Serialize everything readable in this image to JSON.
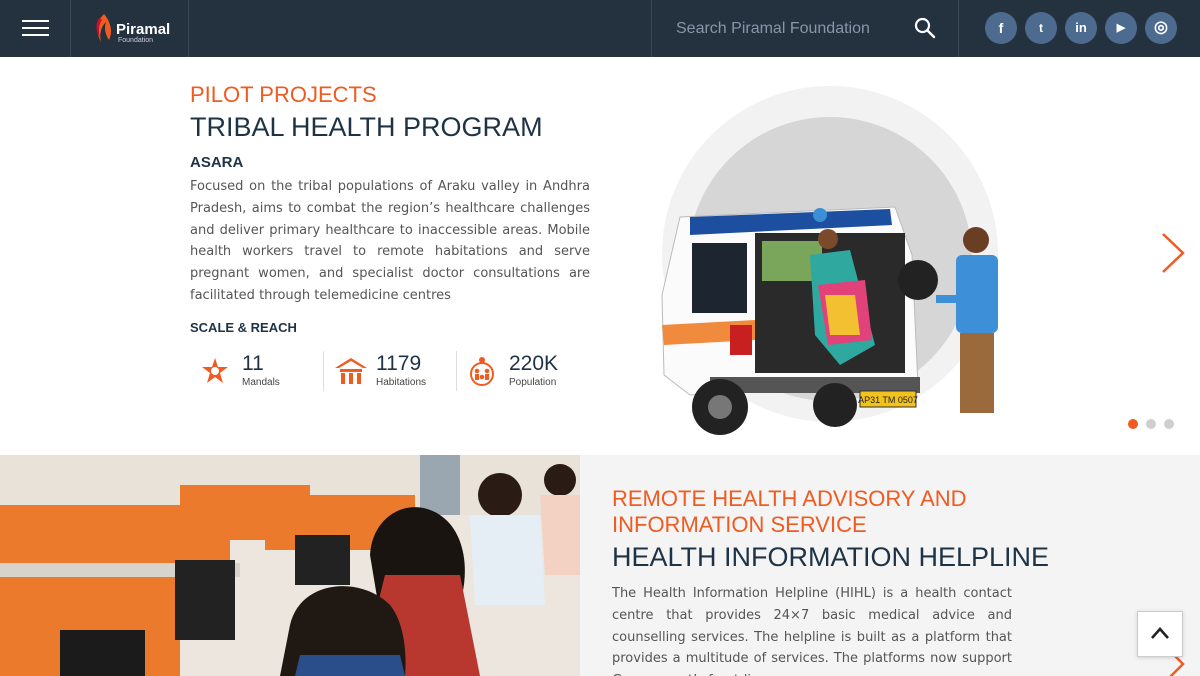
{
  "header": {
    "brand": "Piramal",
    "brand_sub": "Foundation",
    "search_placeholder": "Search Piramal Foundation",
    "social": [
      {
        "icon": "facebook-icon",
        "glyph": "f"
      },
      {
        "icon": "twitter-icon",
        "glyph": "t"
      },
      {
        "icon": "linkedin-icon",
        "glyph": "in"
      },
      {
        "icon": "youtube-icon",
        "glyph": "▶"
      },
      {
        "icon": "instagram-icon",
        "glyph": "◎"
      }
    ]
  },
  "pilot": {
    "kicker": "PILOT PROJECTS",
    "title": "TRIBAL HEALTH PROGRAM",
    "subtitle": "ASARA",
    "description": "Focused on the tribal populations of Araku valley in Andhra Pradesh, aims to combat the region’s healthcare challenges and deliver primary healthcare to inaccessible areas. Mobile health workers travel to remote habitations and serve pregnant women, and specialist doctor consultations are facilitated through telemedicine centres",
    "scale_label": "SCALE & REACH",
    "stats": [
      {
        "value": "11",
        "label": "Mandals",
        "icon": "mandals-icon"
      },
      {
        "value": "1179",
        "label": "Habitations",
        "icon": "habitations-icon"
      },
      {
        "value": "220K",
        "label": "Population",
        "icon": "population-icon"
      }
    ],
    "plate": "AP31 TM 0507",
    "slides": {
      "count": 3,
      "active": 1
    }
  },
  "helpline": {
    "kicker_line1": "REMOTE HEALTH ADVISORY AND",
    "kicker_line2": "INFORMATION SERVICE",
    "title": "HEALTH INFORMATION HELPLINE",
    "description": "The Health Information Helpline (HIHL) is a health contact centre that provides 24×7 basic medical advice and counselling services. The helpline is built as a platform that provides a multitude of services. The platforms now support Government’s front-line"
  },
  "colors": {
    "accent": "#ef5b21",
    "navy": "#1f3346",
    "nav_bg": "#24313f",
    "social_bg": "#4d6b8f"
  }
}
